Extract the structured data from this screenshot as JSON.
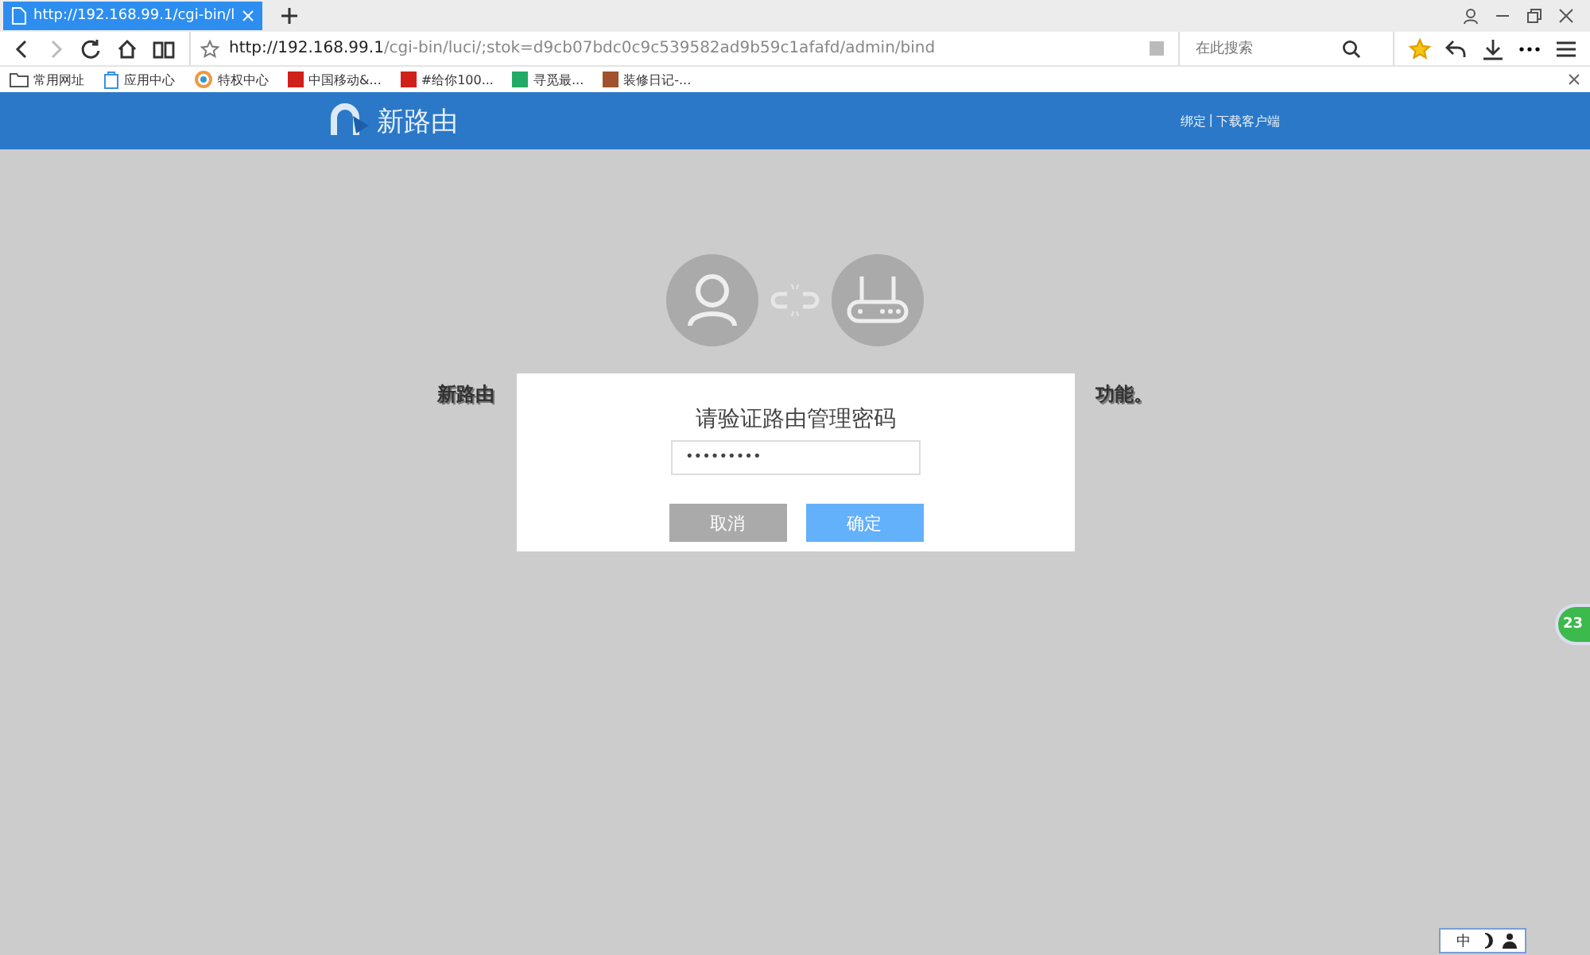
{
  "tabs": [
    {
      "label": "http://192.168.99.1/cgi-bin/l",
      "selected": true
    }
  ],
  "address": {
    "host": "http://192.168.99.1",
    "path": "/cgi-bin/luci/;stok=d9cb07bdc0c9c539582ad9b59c1afafd/admin/bind"
  },
  "search": {
    "placeholder": "在此搜索"
  },
  "bookmarks": [
    {
      "label": "常用网址",
      "kind": "folder"
    },
    {
      "label": "应用中心",
      "kind": "bag"
    },
    {
      "label": "特权中心",
      "kind": "ring"
    },
    {
      "label": "中国移动&...",
      "kind": "jd"
    },
    {
      "label": "#给你100...",
      "kind": "jd"
    },
    {
      "label": "寻觅最...",
      "kind": "flag"
    },
    {
      "label": "装修日记-...",
      "kind": "diary"
    }
  ],
  "header": {
    "logo": "新路由",
    "links": [
      "绑定",
      "下载客户端"
    ],
    "separator": "|"
  },
  "background_text": {
    "left": "新路由",
    "right": "功能。"
  },
  "dialog": {
    "title": "请验证路由管理密码",
    "password": "•••••••••",
    "buttons": [
      {
        "label": "取消",
        "kind": "cancel"
      },
      {
        "label": "确定",
        "kind": "confirm"
      }
    ]
  },
  "floating_badge": "23",
  "ime_bar": {
    "label": "中"
  }
}
